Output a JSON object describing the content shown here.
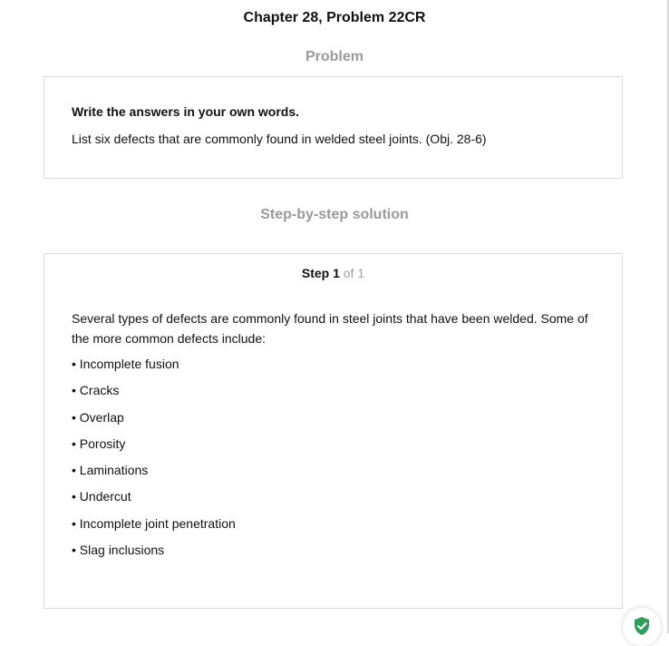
{
  "page": {
    "title": "Chapter 28, Problem 22CR"
  },
  "problem": {
    "heading": "Problem",
    "instruction": "Write the answers in your own words.",
    "question": "List six defects that are commonly found in welded steel joints. (Obj. 28-6)"
  },
  "solution": {
    "heading": "Step-by-step solution",
    "step_word": "Step 1",
    "step_of": "of 1",
    "intro": "Several types of defects are commonly found in steel joints that have been welded. Some of the more common defects include:",
    "defects": [
      "• Incomplete fusion",
      "• Cracks",
      "• Overlap",
      "• Porosity",
      "• Laminations",
      "• Undercut",
      "• Incomplete joint penetration",
      "• Slag inclusions"
    ]
  },
  "badge": {
    "icon": "shield-check-icon",
    "color": "#2e9e5b"
  }
}
